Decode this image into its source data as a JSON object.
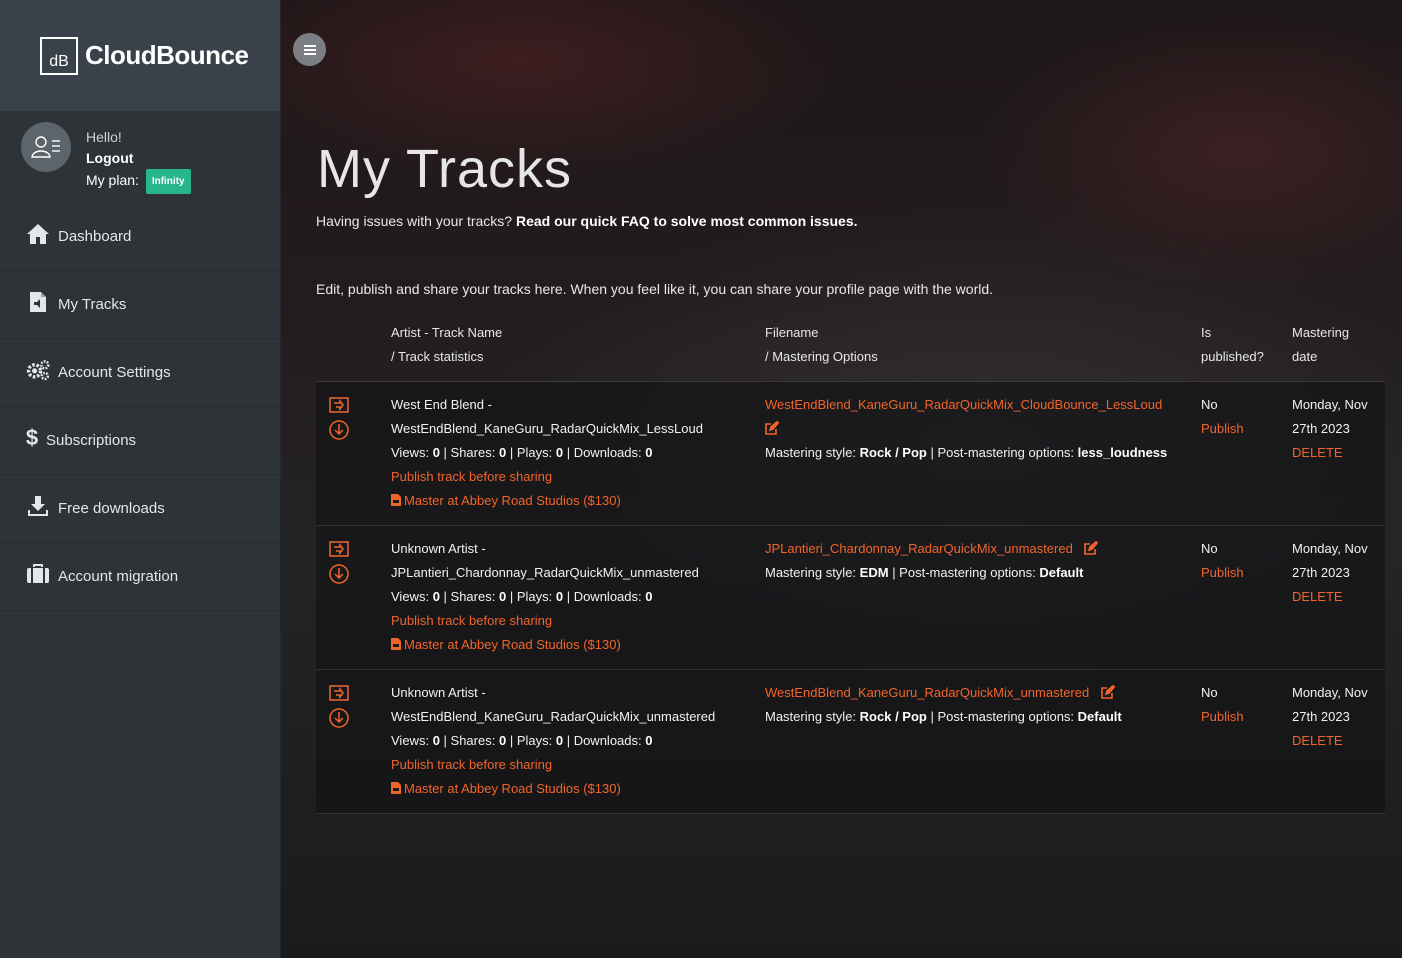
{
  "brand": {
    "mark": "dB",
    "name": "CloudBounce"
  },
  "user": {
    "hello": "Hello!",
    "logout": "Logout",
    "plan_label": "My plan:",
    "plan": "Infinity"
  },
  "nav": [
    {
      "label": "Dashboard",
      "icon": "home-icon"
    },
    {
      "label": "My Tracks",
      "icon": "audio-file-icon"
    },
    {
      "label": "Account Settings",
      "icon": "gears-icon"
    },
    {
      "label": "Subscriptions",
      "icon": "dollar-icon"
    },
    {
      "label": "Free downloads",
      "icon": "download-icon"
    },
    {
      "label": "Account migration",
      "icon": "suitcase-icon"
    }
  ],
  "page": {
    "title": "My Tracks",
    "faq_prefix": "Having issues with your tracks?",
    "faq_link": "Read our quick FAQ to solve most common issues.",
    "intro": "Edit, publish and share your tracks here. When you feel like it, you can share your profile page with the world."
  },
  "table": {
    "headers": {
      "name_1": "Artist - Track Name",
      "name_2": "/ Track statistics",
      "file_1": "Filename",
      "file_2": "/ Mastering Options",
      "pub_1": "Is",
      "pub_2": "published?",
      "date_1": "Mastering",
      "date_2": "date"
    },
    "labels": {
      "views": "Views:",
      "shares": "| Shares:",
      "plays": "| Plays:",
      "downloads": "| Downloads:",
      "publish_before": "Publish track before sharing",
      "master_abbey": "Master at Abbey Road Studios ($130)",
      "style": "Mastering style:",
      "post": "| Post-mastering options:",
      "publish": "Publish",
      "delete": "DELETE"
    },
    "rows": [
      {
        "artist": "West End Blend -",
        "track": "WestEndBlend_KaneGuru_RadarQuickMix_LessLoud",
        "views": "0",
        "shares": "0",
        "plays": "0",
        "downloads": "0",
        "filename": "WestEndBlend_KaneGuru_RadarQuickMix_CloudBounce_LessLoud",
        "style": "Rock / Pop",
        "post": "less_loudness",
        "published": "No",
        "date_1": "Monday, Nov",
        "date_2": "27th 2023"
      },
      {
        "artist": "Unknown Artist -",
        "track": "JPLantieri_Chardonnay_RadarQuickMix_unmastered",
        "views": "0",
        "shares": "0",
        "plays": "0",
        "downloads": "0",
        "filename": "JPLantieri_Chardonnay_RadarQuickMix_unmastered",
        "style": "EDM",
        "post": "Default",
        "published": "No",
        "date_1": "Monday, Nov",
        "date_2": "27th 2023"
      },
      {
        "artist": "Unknown Artist -",
        "track": "WestEndBlend_KaneGuru_RadarQuickMix_unmastered",
        "views": "0",
        "shares": "0",
        "plays": "0",
        "downloads": "0",
        "filename": "WestEndBlend_KaneGuru_RadarQuickMix_unmastered",
        "style": "Rock / Pop",
        "post": "Default",
        "published": "No",
        "date_1": "Monday, Nov",
        "date_2": "27th 2023"
      }
    ]
  },
  "colors": {
    "accent": "#f2652a",
    "badge": "#27b58a",
    "sidebar": "#2e3338"
  }
}
